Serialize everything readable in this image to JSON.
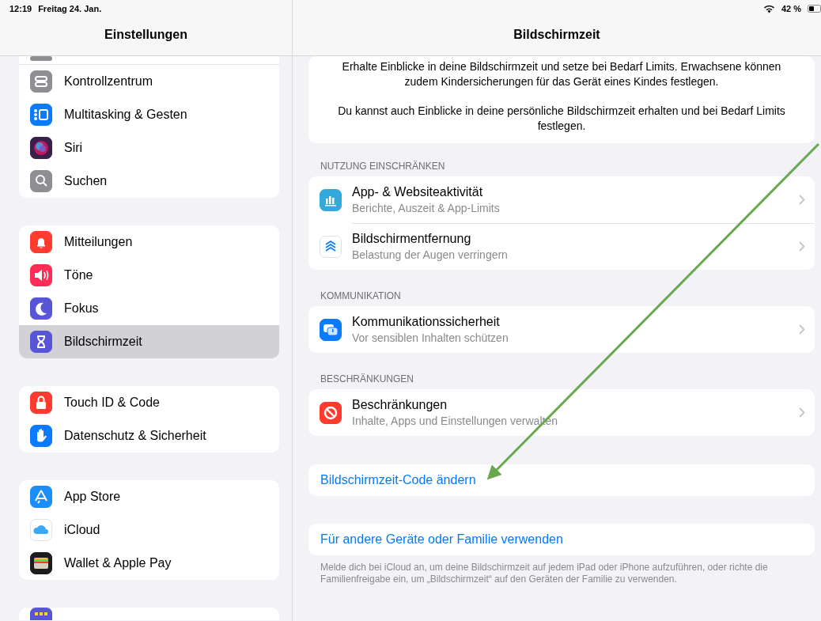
{
  "status_bar": {
    "time": "12:19",
    "date": "Freitag 24. Jan.",
    "battery": "42 %"
  },
  "sidebar": {
    "title": "Einstellungen",
    "groups": [
      {
        "items": [
          {
            "label": "Kontrollzentrum",
            "selected": false
          },
          {
            "label": "Multitasking & Gesten",
            "selected": false
          },
          {
            "label": "Siri",
            "selected": false
          },
          {
            "label": "Suchen",
            "selected": false
          }
        ]
      },
      {
        "items": [
          {
            "label": "Mitteilungen",
            "selected": false
          },
          {
            "label": "Töne",
            "selected": false
          },
          {
            "label": "Fokus",
            "selected": false
          },
          {
            "label": "Bildschirmzeit",
            "selected": true
          }
        ]
      },
      {
        "items": [
          {
            "label": "Touch ID & Code",
            "selected": false
          },
          {
            "label": "Datenschutz & Sicherheit",
            "selected": false
          }
        ]
      },
      {
        "items": [
          {
            "label": "App Store",
            "selected": false
          },
          {
            "label": "iCloud",
            "selected": false
          },
          {
            "label": "Wallet & Apple Pay",
            "selected": false
          }
        ]
      }
    ]
  },
  "detail": {
    "title": "Bildschirmzeit",
    "intro": [
      "Erhalte Einblicke in deine Bildschirmzeit und setze bei Bedarf Limits. Erwachsene können zudem Kindersicherungen für das Gerät eines Kindes festlegen.",
      "Du kannst auch Einblicke in deine persönliche Bildschirmzeit erhalten und bei Bedarf Limits festlegen."
    ],
    "sections": [
      {
        "header": "NUTZUNG EINSCHRÄNKEN",
        "rows": [
          {
            "title": "App- & Websiteaktivität",
            "subtitle": "Berichte, Auszeit & App-Limits"
          },
          {
            "title": "Bildschirmentfernung",
            "subtitle": "Belastung der Augen verringern"
          }
        ]
      },
      {
        "header": "KOMMUNIKATION",
        "rows": [
          {
            "title": "Kommunikationssicherheit",
            "subtitle": "Vor sensiblen Inhalten schützen"
          }
        ]
      },
      {
        "header": "BESCHRÄNKUNGEN",
        "rows": [
          {
            "title": "Beschränkungen",
            "subtitle": "Inhalte, Apps und Einstellungen verwalten"
          }
        ]
      }
    ],
    "links": [
      {
        "label": "Bildschirmzeit-Code ändern"
      },
      {
        "label": "Für andere Geräte oder Familie verwenden",
        "footer": "Melde dich bei iCloud an, um deine Bildschirmzeit auf jedem iPad oder iPhone aufzuführen, oder richte die Familienfreigabe ein, um „Bildschirmzeit“ auf den Geräten der Familie zu verwenden."
      }
    ]
  },
  "annotation": {
    "kind": "arrow"
  }
}
